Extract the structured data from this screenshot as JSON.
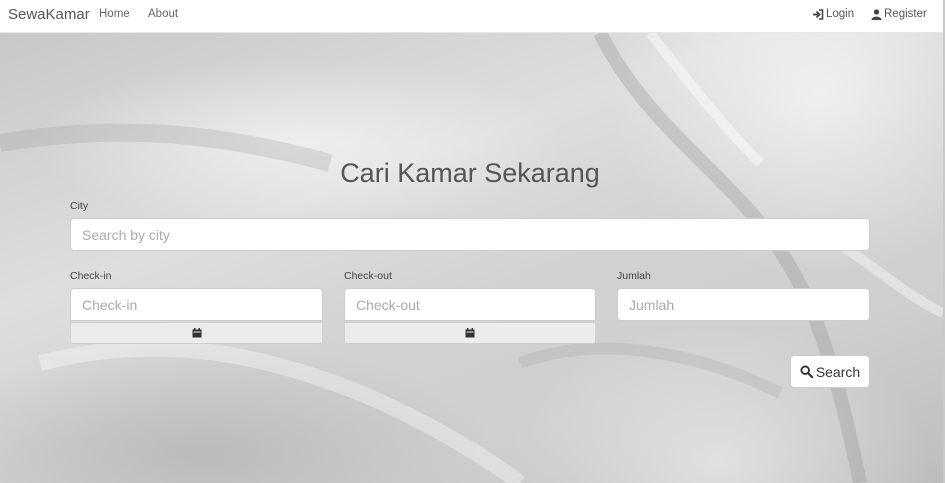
{
  "navbar": {
    "brand": "SewaKamar",
    "links": [
      "Home",
      "About"
    ],
    "login_label": "Login",
    "register_label": "Register"
  },
  "hero": {
    "title": "Cari Kamar Sekarang"
  },
  "form": {
    "city_label": "City",
    "city_placeholder": "Search by city",
    "checkin_label": "Check-in",
    "checkin_placeholder": "Check-in",
    "checkout_label": "Check-out",
    "checkout_placeholder": "Check-out",
    "jumlah_label": "Jumlah",
    "jumlah_placeholder": "Jumlah",
    "search_label": "Search"
  },
  "icons": {
    "login": "sign-in-icon",
    "register": "user-icon",
    "calendar": "calendar-icon",
    "search": "search-icon"
  }
}
